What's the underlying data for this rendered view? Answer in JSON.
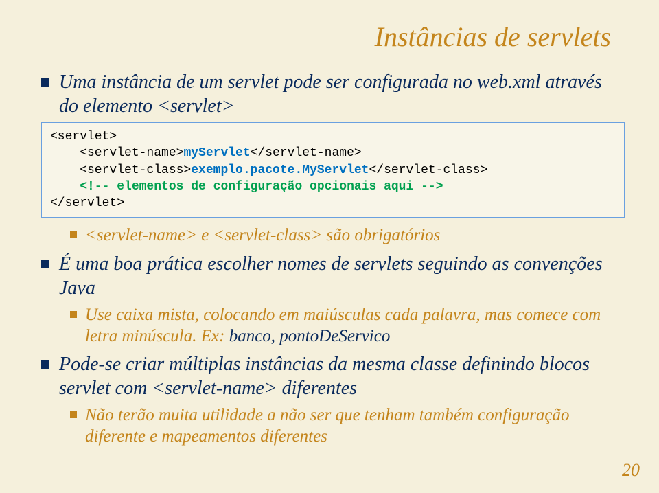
{
  "title": "Instâncias de servlets",
  "b1": "Uma instância de um servlet pode ser configurada no web.xml através do elemento <servlet>",
  "code": {
    "l1a": "<servlet>",
    "l2a": "    <servlet-name>",
    "l2b": "myServlet",
    "l2c": "</servlet-name>",
    "l3a": "    <servlet-class>",
    "l3b": "exemplo.pacote.MyServlet",
    "l3c": "</servlet-class>",
    "l4": "    <!-- elementos de configuração opcionais aqui -->",
    "l5": "</servlet>"
  },
  "b2": "<servlet-name> e <servlet-class> são obrigatórios",
  "b3": "É uma boa prática escolher nomes de servlets seguindo as convenções Java",
  "b3a_pre": "Use caixa mista, colocando em maiúsculas cada palavra, mas comece com letra minúscula. Ex: ",
  "b3a_ex": "banco, pontoDeServico",
  "b4": "Pode-se criar múltiplas instâncias da mesma classe definindo blocos servlet com <servlet-name> diferentes",
  "b4a": "Não terão muita utilidade a não ser que tenham também configuração diferente e mapeamentos diferentes",
  "pagenum": "20"
}
